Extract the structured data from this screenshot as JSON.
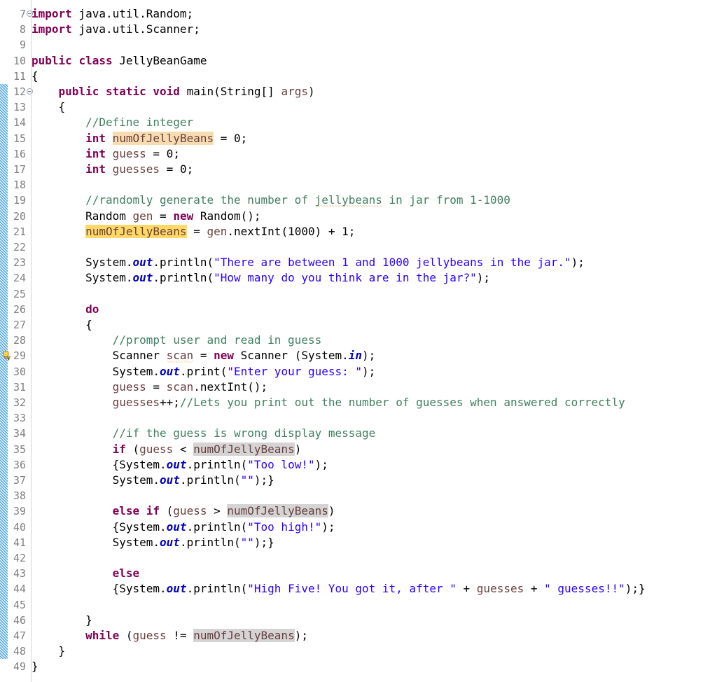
{
  "editor": {
    "language": "java",
    "class_name": "JellyBeanGame",
    "first_visible_line": 7,
    "last_visible_line": 49,
    "line_height_px": 22.2,
    "colors": {
      "background": "#ffffff",
      "line_number": "#808080",
      "keyword": "#7f0055",
      "comment": "#3f7f5f",
      "string": "#2a00ff",
      "static_field": "#0000c0",
      "local_var": "#6a3e3e",
      "plain": "#000000",
      "occurrence_write_declaration": "#f6dcb0",
      "occurrence_write": "#ffd966",
      "occurrence_read": "#d4d4d4",
      "change_bar": "#54a8e0",
      "spell_squiggle": "#d98c2a",
      "warning_squiggle": "#c8a000"
    },
    "change_bar_lines": [
      12,
      48
    ],
    "fold_marker_lines": [
      7,
      12
    ],
    "markers": [
      {
        "line": 29,
        "icon": "warning-lightbulb-icon",
        "kind": "warning"
      }
    ],
    "selected_identifier": "numOfJellyBeans"
  },
  "lines": [
    {
      "n": 7,
      "tokens": [
        {
          "t": "import",
          "c": "kw"
        },
        {
          "t": " java.util.Random;",
          "c": "pln"
        }
      ]
    },
    {
      "n": 8,
      "tokens": [
        {
          "t": "import",
          "c": "kw"
        },
        {
          "t": " java.util.Scanner;",
          "c": "pln"
        }
      ]
    },
    {
      "n": 9,
      "tokens": []
    },
    {
      "n": 10,
      "tokens": [
        {
          "t": "public",
          "c": "kw"
        },
        {
          "t": " ",
          "c": "pln"
        },
        {
          "t": "class",
          "c": "kw"
        },
        {
          "t": " JellyBeanGame",
          "c": "pln"
        }
      ]
    },
    {
      "n": 11,
      "tokens": [
        {
          "t": "{",
          "c": "pln"
        }
      ]
    },
    {
      "n": 12,
      "tokens": [
        {
          "t": "    ",
          "c": "pln"
        },
        {
          "t": "public",
          "c": "kw"
        },
        {
          "t": " ",
          "c": "pln"
        },
        {
          "t": "static",
          "c": "kw"
        },
        {
          "t": " ",
          "c": "pln"
        },
        {
          "t": "void",
          "c": "kw"
        },
        {
          "t": " main(String[] ",
          "c": "pln"
        },
        {
          "t": "args",
          "c": "loc"
        },
        {
          "t": ")",
          "c": "pln"
        }
      ]
    },
    {
      "n": 13,
      "tokens": [
        {
          "t": "    {",
          "c": "pln"
        }
      ]
    },
    {
      "n": 14,
      "tokens": [
        {
          "t": "        ",
          "c": "pln"
        },
        {
          "t": "//Define integer",
          "c": "cmt"
        }
      ]
    },
    {
      "n": 15,
      "tokens": [
        {
          "t": "        ",
          "c": "pln"
        },
        {
          "t": "int",
          "c": "kw"
        },
        {
          "t": " ",
          "c": "pln"
        },
        {
          "t": "numOfJellyBeans",
          "c": "loc",
          "hl": "occ-write-decl"
        },
        {
          "t": " = 0;",
          "c": "pln"
        }
      ]
    },
    {
      "n": 16,
      "tokens": [
        {
          "t": "        ",
          "c": "pln"
        },
        {
          "t": "int",
          "c": "kw"
        },
        {
          "t": " ",
          "c": "pln"
        },
        {
          "t": "guess",
          "c": "loc"
        },
        {
          "t": " = 0;",
          "c": "pln"
        }
      ]
    },
    {
      "n": 17,
      "tokens": [
        {
          "t": "        ",
          "c": "pln"
        },
        {
          "t": "int",
          "c": "kw"
        },
        {
          "t": " ",
          "c": "pln"
        },
        {
          "t": "guesses",
          "c": "loc"
        },
        {
          "t": " = 0;",
          "c": "pln"
        }
      ]
    },
    {
      "n": 18,
      "tokens": []
    },
    {
      "n": 19,
      "tokens": [
        {
          "t": "        ",
          "c": "pln"
        },
        {
          "t": "//randomly generate the number of ",
          "c": "cmt"
        },
        {
          "t": "jellybeans",
          "c": "cmt",
          "sq": "sq-spell"
        },
        {
          "t": " in jar from 1-1000",
          "c": "cmt"
        }
      ]
    },
    {
      "n": 20,
      "tokens": [
        {
          "t": "        Random ",
          "c": "pln"
        },
        {
          "t": "gen",
          "c": "loc"
        },
        {
          "t": " = ",
          "c": "pln"
        },
        {
          "t": "new",
          "c": "kw"
        },
        {
          "t": " Random();",
          "c": "pln"
        }
      ]
    },
    {
      "n": 21,
      "tokens": [
        {
          "t": "        ",
          "c": "pln"
        },
        {
          "t": "numOfJellyBeans",
          "c": "loc",
          "hl": "occ-write"
        },
        {
          "t": " = ",
          "c": "pln"
        },
        {
          "t": "gen",
          "c": "loc"
        },
        {
          "t": ".nextInt(1000) + 1;",
          "c": "pln"
        }
      ]
    },
    {
      "n": 22,
      "tokens": []
    },
    {
      "n": 23,
      "tokens": [
        {
          "t": "        System.",
          "c": "pln"
        },
        {
          "t": "out",
          "c": "fld"
        },
        {
          "t": ".println(",
          "c": "pln"
        },
        {
          "t": "\"There are between 1 and 1000 jellybeans in the jar.\"",
          "c": "str"
        },
        {
          "t": ");",
          "c": "pln"
        }
      ]
    },
    {
      "n": 24,
      "tokens": [
        {
          "t": "        System.",
          "c": "pln"
        },
        {
          "t": "out",
          "c": "fld"
        },
        {
          "t": ".println(",
          "c": "pln"
        },
        {
          "t": "\"How many do you think are in the jar?\"",
          "c": "str"
        },
        {
          "t": ");",
          "c": "pln"
        }
      ]
    },
    {
      "n": 25,
      "tokens": []
    },
    {
      "n": 26,
      "tokens": [
        {
          "t": "        ",
          "c": "pln"
        },
        {
          "t": "do",
          "c": "kw"
        }
      ]
    },
    {
      "n": 27,
      "tokens": [
        {
          "t": "        {",
          "c": "pln"
        }
      ]
    },
    {
      "n": 28,
      "tokens": [
        {
          "t": "            ",
          "c": "pln"
        },
        {
          "t": "//prompt user and read in guess",
          "c": "cmt"
        }
      ]
    },
    {
      "n": 29,
      "tokens": [
        {
          "t": "            Scanner ",
          "c": "pln"
        },
        {
          "t": "scan",
          "c": "loc",
          "sq": "sq-warn"
        },
        {
          "t": " = ",
          "c": "pln"
        },
        {
          "t": "new",
          "c": "kw"
        },
        {
          "t": " Scanner (System.",
          "c": "pln"
        },
        {
          "t": "in",
          "c": "fld"
        },
        {
          "t": ");",
          "c": "pln"
        }
      ]
    },
    {
      "n": 30,
      "tokens": [
        {
          "t": "            System.",
          "c": "pln"
        },
        {
          "t": "out",
          "c": "fld"
        },
        {
          "t": ".print(",
          "c": "pln"
        },
        {
          "t": "\"Enter your guess: \"",
          "c": "str"
        },
        {
          "t": ");",
          "c": "pln"
        }
      ]
    },
    {
      "n": 31,
      "tokens": [
        {
          "t": "            ",
          "c": "pln"
        },
        {
          "t": "guess",
          "c": "loc"
        },
        {
          "t": " = ",
          "c": "pln"
        },
        {
          "t": "scan",
          "c": "loc"
        },
        {
          "t": ".nextInt();",
          "c": "pln"
        }
      ]
    },
    {
      "n": 32,
      "tokens": [
        {
          "t": "            ",
          "c": "pln"
        },
        {
          "t": "guesses",
          "c": "loc"
        },
        {
          "t": "++;",
          "c": "pln"
        },
        {
          "t": "//Lets you print out the number of guesses when answered correctly",
          "c": "cmt"
        }
      ]
    },
    {
      "n": 33,
      "tokens": []
    },
    {
      "n": 34,
      "tokens": [
        {
          "t": "            ",
          "c": "pln"
        },
        {
          "t": "//if the guess is wrong display message",
          "c": "cmt"
        }
      ]
    },
    {
      "n": 35,
      "tokens": [
        {
          "t": "            ",
          "c": "pln"
        },
        {
          "t": "if",
          "c": "kw"
        },
        {
          "t": " (",
          "c": "pln"
        },
        {
          "t": "guess",
          "c": "loc"
        },
        {
          "t": " < ",
          "c": "pln"
        },
        {
          "t": "numOfJellyBeans",
          "c": "loc",
          "hl": "occ-read"
        },
        {
          "t": ")",
          "c": "pln"
        }
      ]
    },
    {
      "n": 36,
      "tokens": [
        {
          "t": "            {System.",
          "c": "pln"
        },
        {
          "t": "out",
          "c": "fld"
        },
        {
          "t": ".println(",
          "c": "pln"
        },
        {
          "t": "\"Too low!\"",
          "c": "str"
        },
        {
          "t": ");",
          "c": "pln"
        }
      ]
    },
    {
      "n": 37,
      "tokens": [
        {
          "t": "            System.",
          "c": "pln"
        },
        {
          "t": "out",
          "c": "fld"
        },
        {
          "t": ".println(",
          "c": "pln"
        },
        {
          "t": "\"\"",
          "c": "str"
        },
        {
          "t": ");}",
          "c": "pln"
        }
      ]
    },
    {
      "n": 38,
      "tokens": []
    },
    {
      "n": 39,
      "tokens": [
        {
          "t": "            ",
          "c": "pln"
        },
        {
          "t": "else",
          "c": "kw"
        },
        {
          "t": " ",
          "c": "pln"
        },
        {
          "t": "if",
          "c": "kw"
        },
        {
          "t": " (",
          "c": "pln"
        },
        {
          "t": "guess",
          "c": "loc"
        },
        {
          "t": " > ",
          "c": "pln"
        },
        {
          "t": "numOfJellyBeans",
          "c": "loc",
          "hl": "occ-read"
        },
        {
          "t": ")",
          "c": "pln"
        }
      ]
    },
    {
      "n": 40,
      "tokens": [
        {
          "t": "            {System.",
          "c": "pln"
        },
        {
          "t": "out",
          "c": "fld"
        },
        {
          "t": ".println(",
          "c": "pln"
        },
        {
          "t": "\"Too high!\"",
          "c": "str"
        },
        {
          "t": ");",
          "c": "pln"
        }
      ]
    },
    {
      "n": 41,
      "tokens": [
        {
          "t": "            System.",
          "c": "pln"
        },
        {
          "t": "out",
          "c": "fld"
        },
        {
          "t": ".println(",
          "c": "pln"
        },
        {
          "t": "\"\"",
          "c": "str"
        },
        {
          "t": ");}",
          "c": "pln"
        }
      ]
    },
    {
      "n": 42,
      "tokens": []
    },
    {
      "n": 43,
      "tokens": [
        {
          "t": "            ",
          "c": "pln"
        },
        {
          "t": "else",
          "c": "kw"
        }
      ]
    },
    {
      "n": 44,
      "tokens": [
        {
          "t": "            {System.",
          "c": "pln"
        },
        {
          "t": "out",
          "c": "fld"
        },
        {
          "t": ".println(",
          "c": "pln"
        },
        {
          "t": "\"High Five! You got it, after \"",
          "c": "str"
        },
        {
          "t": " + ",
          "c": "pln"
        },
        {
          "t": "guesses",
          "c": "loc"
        },
        {
          "t": " + ",
          "c": "pln"
        },
        {
          "t": "\" guesses!!\"",
          "c": "str"
        },
        {
          "t": ");}",
          "c": "pln"
        }
      ]
    },
    {
      "n": 45,
      "tokens": []
    },
    {
      "n": 46,
      "tokens": [
        {
          "t": "        }",
          "c": "pln"
        }
      ]
    },
    {
      "n": 47,
      "tokens": [
        {
          "t": "        ",
          "c": "pln"
        },
        {
          "t": "while",
          "c": "kw"
        },
        {
          "t": " (",
          "c": "pln"
        },
        {
          "t": "guess",
          "c": "loc"
        },
        {
          "t": " != ",
          "c": "pln"
        },
        {
          "t": "numOfJellyBeans",
          "c": "loc",
          "hl": "occ-read"
        },
        {
          "t": ");",
          "c": "pln"
        }
      ]
    },
    {
      "n": 48,
      "tokens": [
        {
          "t": "    }",
          "c": "pln"
        }
      ]
    },
    {
      "n": 49,
      "tokens": [
        {
          "t": "}",
          "c": "pln"
        }
      ]
    }
  ]
}
